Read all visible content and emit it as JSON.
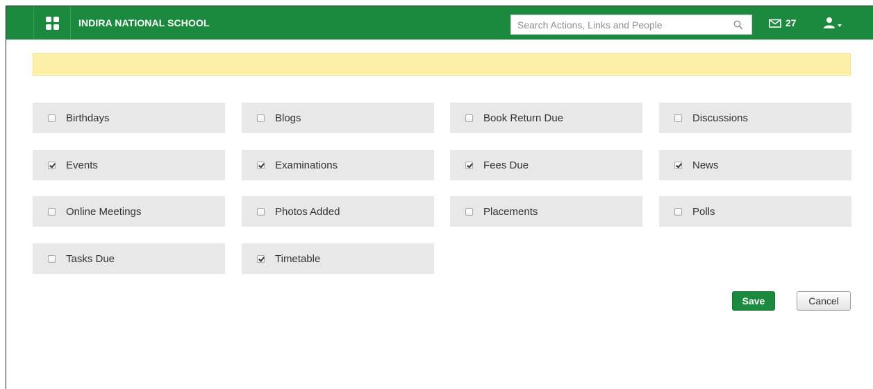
{
  "theme": {
    "brand_color": "#1c8a3e",
    "notice_color": "#fff0a8"
  },
  "header": {
    "apps_icon": "apps-grid-icon",
    "school_name": "INDIRA NATIONAL SCHOOL",
    "search": {
      "placeholder": "Search Actions, Links and People",
      "value": "",
      "icon": "search-icon"
    },
    "mail": {
      "icon": "mail-icon",
      "count": "27"
    },
    "user": {
      "icon": "user-icon"
    }
  },
  "notice": {
    "text": ""
  },
  "options": [
    {
      "label": "Birthdays",
      "checked": false
    },
    {
      "label": "Blogs",
      "checked": false
    },
    {
      "label": "Book Return Due",
      "checked": false
    },
    {
      "label": "Discussions",
      "checked": false
    },
    {
      "label": "Events",
      "checked": true
    },
    {
      "label": "Examinations",
      "checked": true
    },
    {
      "label": "Fees Due",
      "checked": true
    },
    {
      "label": "News",
      "checked": true
    },
    {
      "label": "Online Meetings",
      "checked": false
    },
    {
      "label": "Photos Added",
      "checked": false
    },
    {
      "label": "Placements",
      "checked": false
    },
    {
      "label": "Polls",
      "checked": false
    },
    {
      "label": "Tasks Due",
      "checked": false
    },
    {
      "label": "Timetable",
      "checked": true
    }
  ],
  "actions": {
    "save_label": "Save",
    "cancel_label": "Cancel"
  }
}
